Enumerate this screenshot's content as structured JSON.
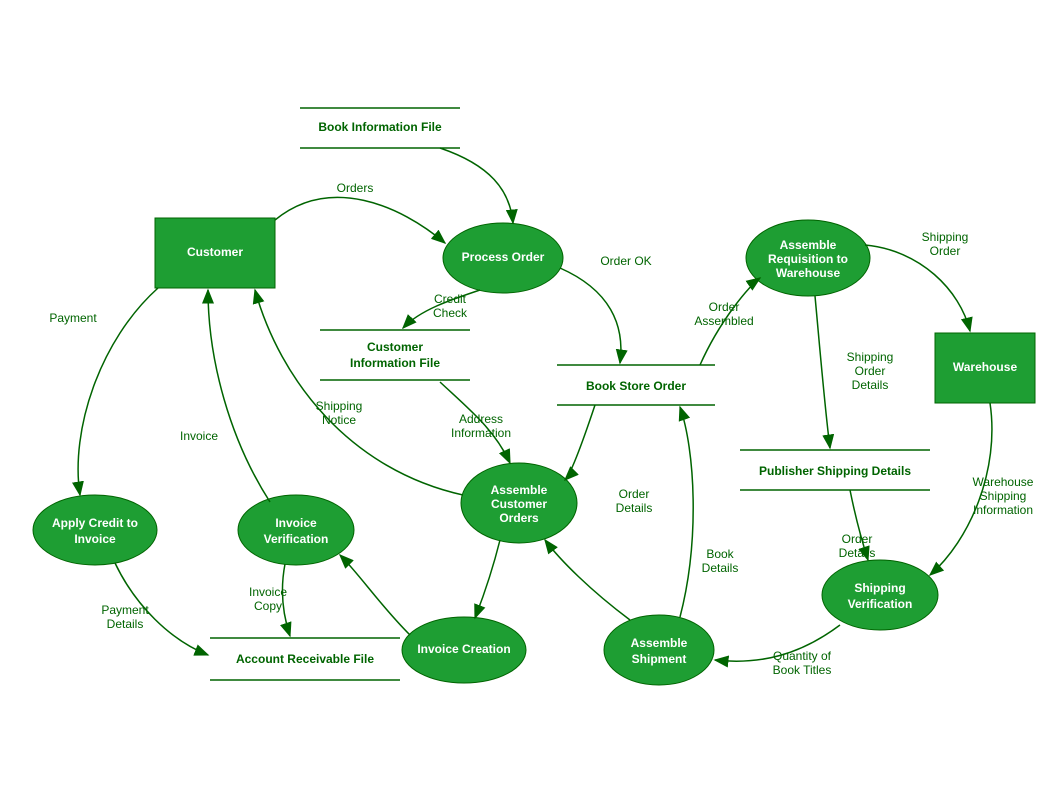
{
  "diagram": {
    "type": "data-flow-diagram",
    "externalEntities": {
      "customer": "Customer",
      "warehouse": "Warehouse"
    },
    "processes": {
      "processOrder": "Process Order",
      "assembleRequisition": [
        "Assemble",
        "Requisition to",
        "Warehouse"
      ],
      "assembleCustomerOrders": [
        "Assemble",
        "Customer",
        "Orders"
      ],
      "applyCredit": [
        "Apply Credit to",
        "Invoice"
      ],
      "invoiceVerification": [
        "Invoice",
        "Verification"
      ],
      "invoiceCreation": "Invoice Creation",
      "assembleShipment": [
        "Assemble",
        "Shipment"
      ],
      "shippingVerification": [
        "Shipping",
        "Verification"
      ]
    },
    "dataStores": {
      "bookInfoFile": "Book Information File",
      "customerInfoFile": [
        "Customer",
        "Information File"
      ],
      "bookStoreOrder": "Book Store Order",
      "publisherShippingDetails": "Publisher Shipping Details",
      "accountReceivableFile": "Account Receivable File"
    },
    "flows": {
      "orders": "Orders",
      "payment": "Payment",
      "invoice": "Invoice",
      "creditCheck": [
        "Credit",
        "Check"
      ],
      "shippingNotice": [
        "Shipping",
        "Notice"
      ],
      "addressInformation": [
        "Address",
        "Information"
      ],
      "orderOK": "Order OK",
      "orderDetails": [
        "Order",
        "Details"
      ],
      "bookDetails": [
        "Book",
        "Details"
      ],
      "orderAssembled": [
        "Order",
        "Assembled"
      ],
      "shippingOrder": [
        "Shipping",
        "Order"
      ],
      "shippingOrderDetails": [
        "Shipping",
        "Order",
        "Details"
      ],
      "warehouseShippingInfo": [
        "Warehouse",
        "Shipping",
        "Information"
      ],
      "orderDetailsSV": [
        "Order",
        "Details"
      ],
      "quantityBookTitles": [
        "Quantity of",
        "Book Titles"
      ],
      "invoiceCopy": [
        "Invoice",
        "Copy"
      ],
      "paymentDetails": [
        "Payment",
        "Details"
      ]
    }
  }
}
